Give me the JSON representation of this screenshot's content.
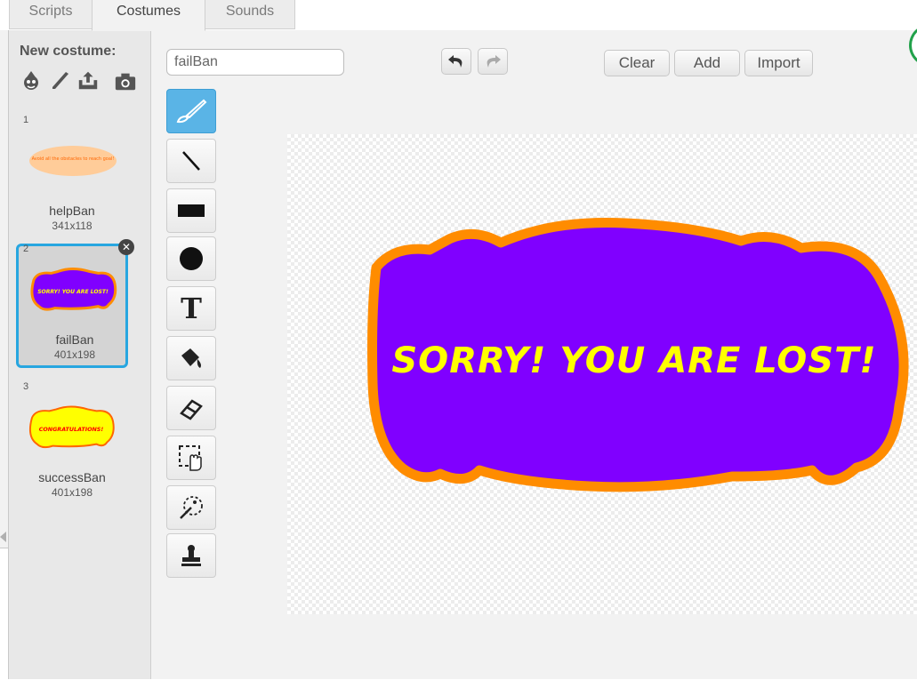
{
  "tabs": [
    {
      "label": "Scripts"
    },
    {
      "label": "Costumes"
    },
    {
      "label": "Sounds"
    }
  ],
  "costume_panel": {
    "new_costume_label": "New costume:",
    "new_costume_icons": [
      "sprite-library-icon",
      "paintbrush-icon",
      "upload-icon",
      "camera-icon"
    ],
    "costumes": [
      {
        "number": "1",
        "name": "helpBan",
        "size": "341x118",
        "thumb_text": "Avoid all the obstacles to reach goal!",
        "thumb_fill": "#ffcc99",
        "thumb_stroke": "#ffcc99",
        "thumb_text_color": "#ff6600"
      },
      {
        "number": "2",
        "name": "failBan",
        "size": "401x198",
        "thumb_text": "SORRY! YOU ARE LOST!",
        "thumb_fill": "#8000ff",
        "thumb_stroke": "#ff8c00",
        "thumb_text_color": "#ffff00"
      },
      {
        "number": "3",
        "name": "successBan",
        "size": "401x198",
        "thumb_text": "CONGRATULATIONS!",
        "thumb_fill": "#ffff00",
        "thumb_stroke": "#ff6600",
        "thumb_text_color": "#ff0000"
      }
    ],
    "selected_index": 1,
    "delete_glyph": "✕"
  },
  "editor": {
    "costume_name_value": "failBan",
    "buttons": {
      "clear": "Clear",
      "add": "Add",
      "import": "Import"
    },
    "tools": [
      "brush-tool",
      "line-tool",
      "rectangle-tool",
      "ellipse-tool",
      "text-tool",
      "fill-tool",
      "eraser-tool",
      "select-tool",
      "magic-select-tool",
      "stamp-tool"
    ],
    "text_tool_glyph": "T",
    "banner": {
      "text": "SORRY! YOU ARE LOST!",
      "fill_color": "#8000ff",
      "outline_color": "#ff8c00",
      "text_color": "#ffff00"
    }
  },
  "colors": {
    "selection_border": "#27a6e0",
    "active_tool": "#5ab4e6",
    "green_flag_ring": "#21a14a"
  }
}
